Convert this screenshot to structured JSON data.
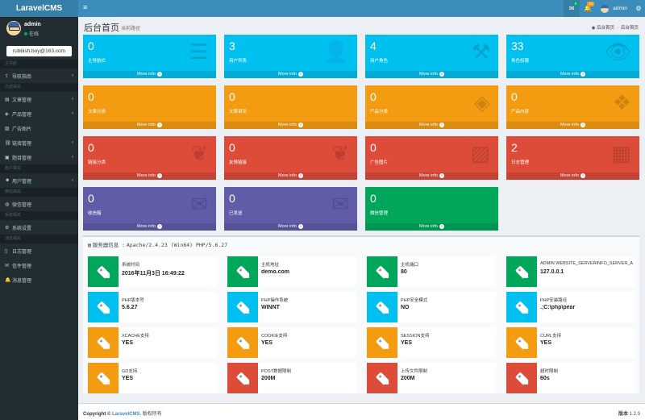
{
  "app_title": "LaravelCMS",
  "sidebar": {
    "user_name": "admin",
    "user_status": "在线",
    "email": "rubbish.boy@163.com",
    "items": [
      {
        "type": "header",
        "label": "主导航"
      },
      {
        "type": "item",
        "icon": "share-icon",
        "label": "导航指南",
        "arrow": true
      },
      {
        "type": "header",
        "label": "内容相关"
      },
      {
        "type": "item",
        "icon": "book-icon",
        "label": "文章管理",
        "arrow": true
      },
      {
        "type": "item",
        "icon": "cube-icon",
        "label": "产品管理",
        "arrow": true
      },
      {
        "type": "item",
        "icon": "image-icon",
        "label": "广告图片",
        "arrow": false
      },
      {
        "type": "item",
        "icon": "link-icon",
        "label": "链接管理",
        "arrow": true
      },
      {
        "type": "item",
        "icon": "folder-icon",
        "label": "题目管理",
        "arrow": true
      },
      {
        "type": "header",
        "label": "账户相关"
      },
      {
        "type": "item",
        "icon": "users-icon",
        "label": "用户管理",
        "arrow": true
      },
      {
        "type": "header",
        "label": "微信相关"
      },
      {
        "type": "item",
        "icon": "wechat-icon",
        "label": "微信管理",
        "arrow": false
      },
      {
        "type": "header",
        "label": "系统相关"
      },
      {
        "type": "item",
        "icon": "gear-icon",
        "label": "系统设置",
        "arrow": false
      },
      {
        "type": "header",
        "label": "消息相关"
      },
      {
        "type": "item",
        "icon": "file-icon",
        "label": "日志管理",
        "arrow": false
      },
      {
        "type": "item",
        "icon": "mail-icon",
        "label": "信件管理",
        "arrow": false
      },
      {
        "type": "item",
        "icon": "bell-icon",
        "label": "消息管理",
        "arrow": false
      }
    ]
  },
  "topbar": {
    "mail_badge": "0",
    "notify_badge": "10",
    "user_name": "admin"
  },
  "header": {
    "title": "后台首页",
    "subtitle": "当前路径",
    "breadcrumb_home": "后台首页",
    "breadcrumb_current": "后台首页"
  },
  "tiles": [
    {
      "num": "0",
      "label": "主导航栏",
      "color": "#00c0ef",
      "icon": "bars-icon",
      "glyph": "☰",
      "more": "More info"
    },
    {
      "num": "3",
      "label": "用户列表",
      "color": "#00c0ef",
      "icon": "user-icon",
      "glyph": "👤",
      "more": "More info"
    },
    {
      "num": "4",
      "label": "用户角色",
      "color": "#00c0ef",
      "icon": "gavel-icon",
      "glyph": "⚒",
      "more": "More info"
    },
    {
      "num": "33",
      "label": "角色权限",
      "color": "#00c0ef",
      "icon": "eye-icon",
      "glyph": "👁",
      "more": "More info"
    },
    {
      "num": "0",
      "label": "文章分类",
      "color": "#f39c12",
      "icon": "tag-icon",
      "glyph": "",
      "more": "More info"
    },
    {
      "num": "0",
      "label": "文章资讯",
      "color": "#f39c12",
      "icon": "tag-icon",
      "glyph": "",
      "more": "More info"
    },
    {
      "num": "0",
      "label": "产品分类",
      "color": "#f39c12",
      "icon": "cube-icon",
      "glyph": "◈",
      "more": "More info"
    },
    {
      "num": "0",
      "label": "产品内容",
      "color": "#f39c12",
      "icon": "cubes-icon",
      "glyph": "❖",
      "more": "More info"
    },
    {
      "num": "0",
      "label": "链接分类",
      "color": "#dd4b39",
      "icon": "leaf-icon",
      "glyph": "❦",
      "more": "More info"
    },
    {
      "num": "0",
      "label": "友情链接",
      "color": "#dd4b39",
      "icon": "leaf-icon",
      "glyph": "❦",
      "more": "More info"
    },
    {
      "num": "0",
      "label": "广告图片",
      "color": "#dd4b39",
      "icon": "picture-icon",
      "glyph": "▨",
      "more": "More info"
    },
    {
      "num": "2",
      "label": "日志管理",
      "color": "#dd4b39",
      "icon": "calendar-icon",
      "glyph": "▦",
      "more": "More info"
    },
    {
      "num": "0",
      "label": "收信箱",
      "color": "#605ca8",
      "icon": "envelope-icon",
      "glyph": "✉",
      "more": "More info"
    },
    {
      "num": "0",
      "label": "已发送",
      "color": "#605ca8",
      "icon": "envelope-icon",
      "glyph": "✉",
      "more": "More info"
    },
    {
      "num": "0",
      "label": "微信管理",
      "color": "#00a65a",
      "icon": "wechat-icon",
      "glyph": "",
      "more": "More info"
    }
  ],
  "server": {
    "title_label": "服务器信息 :",
    "title_value": "Apache/2.4.23 (Win64) PHP/5.6.27",
    "items": [
      {
        "key": "系统时间",
        "value": "2016年11月3日 16:49:22",
        "color": "#00a65a"
      },
      {
        "key": "主机地址",
        "value": "demo.com",
        "color": "#00a65a"
      },
      {
        "key": "主机端口",
        "value": "80",
        "color": "#00a65a"
      },
      {
        "key": "ADMIN WEBSITE_SERVERINFO_SERVER_ADDR",
        "value": "127.0.0.1",
        "color": "#00a65a"
      },
      {
        "key": "PHP版本号",
        "value": "5.6.27",
        "color": "#00c0ef"
      },
      {
        "key": "PHP操作系统",
        "value": "WINNT",
        "color": "#00c0ef"
      },
      {
        "key": "PHP安全模式",
        "value": "NO",
        "color": "#00c0ef"
      },
      {
        "key": "PHP安装路径",
        "value": ".;C:\\php\\pear",
        "color": "#00c0ef"
      },
      {
        "key": "XCACHE支持",
        "value": "YES",
        "color": "#f39c12"
      },
      {
        "key": "COOKIE支持",
        "value": "YES",
        "color": "#f39c12"
      },
      {
        "key": "SESSION支持",
        "value": "YES",
        "color": "#f39c12"
      },
      {
        "key": "CURL支持",
        "value": "YES",
        "color": "#f39c12"
      },
      {
        "key": "GD支持",
        "value": "YES",
        "color": "#f39c12"
      },
      {
        "key": "POST数据限制",
        "value": "200M",
        "color": "#dd4b39"
      },
      {
        "key": "上传文件限制",
        "value": "200M",
        "color": "#dd4b39"
      },
      {
        "key": "超时限制",
        "value": "60s",
        "color": "#dd4b39"
      }
    ]
  },
  "footer": {
    "copyright_prefix": "Copyright ©",
    "brand": "LaravelCMS",
    "rights": ". 版权所有",
    "version_label": "版本",
    "version": "1.2.0"
  }
}
